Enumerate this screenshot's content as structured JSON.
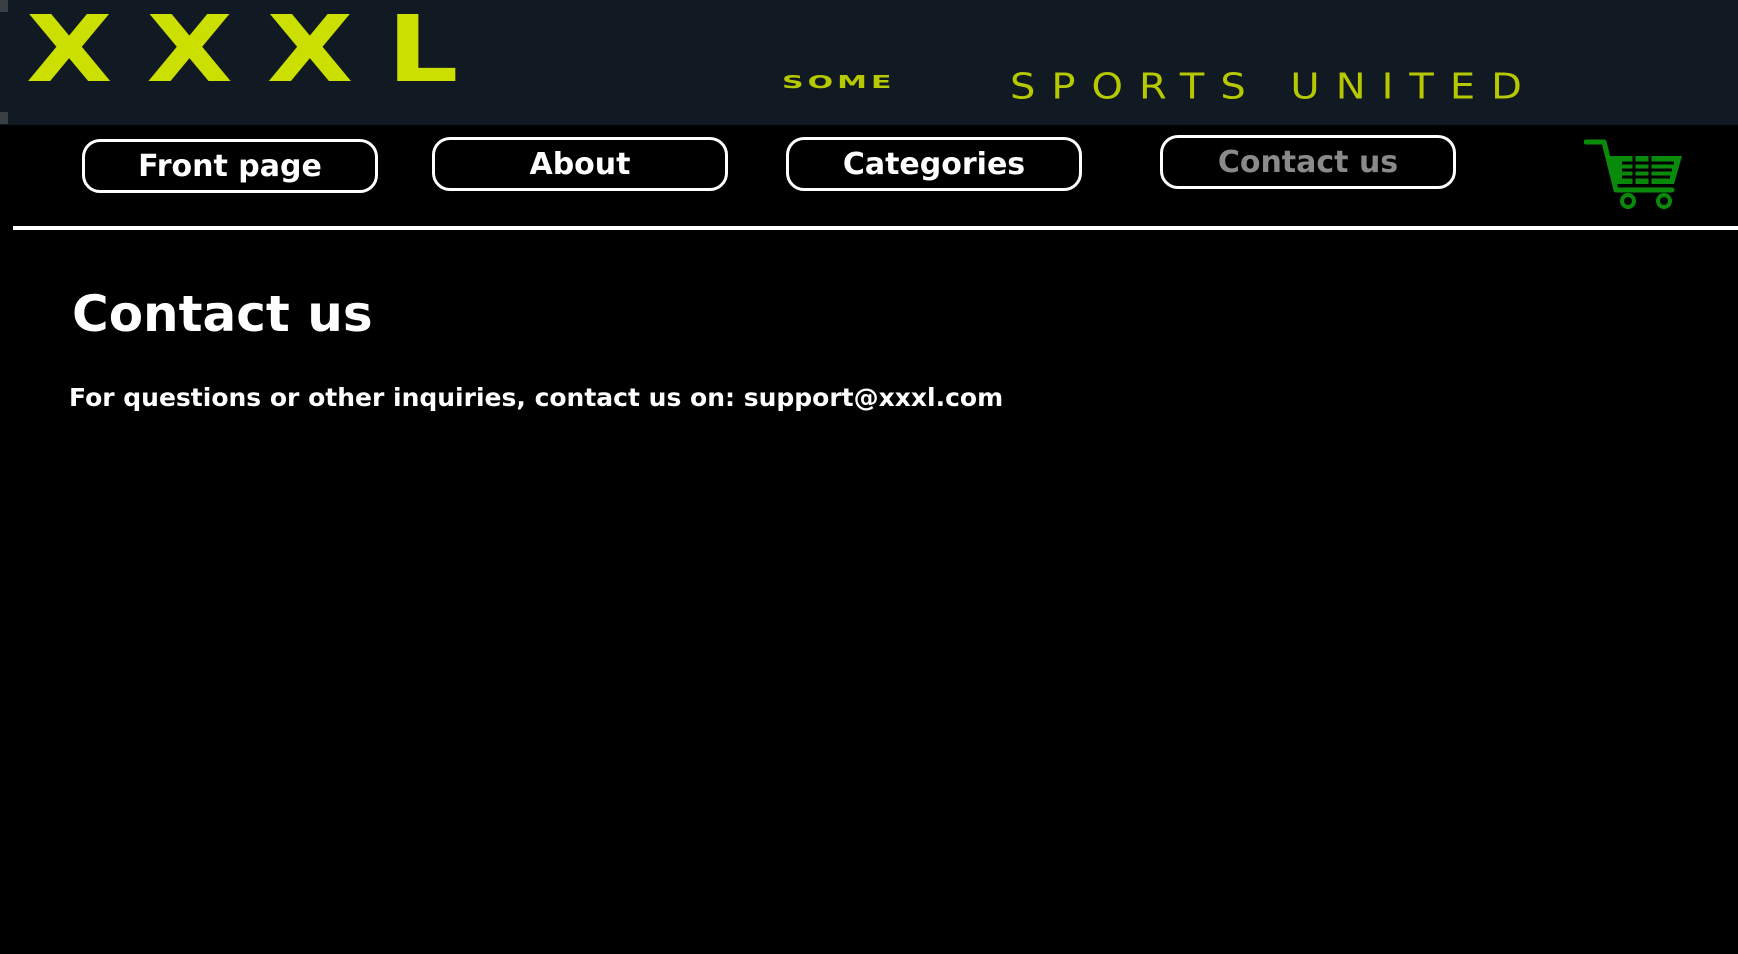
{
  "header": {
    "logo_text": "XXXL",
    "tagline_part1": "SOME",
    "tagline_part2": "SPORTS UNITED",
    "brand_color": "#cbe000",
    "banner_bg": "#111a22"
  },
  "nav": {
    "items": [
      {
        "label": "Front page",
        "active": false
      },
      {
        "label": "About",
        "active": false
      },
      {
        "label": "Categories",
        "active": false
      },
      {
        "label": "Contact us",
        "active": true
      }
    ],
    "active_color": "#8a8a8a",
    "cart_icon": "shopping-cart-icon",
    "cart_color": "#0a8a0a"
  },
  "main": {
    "title": "Contact us",
    "contact_text": "For questions or other inquiries, contact us on: support@xxxl.com"
  }
}
